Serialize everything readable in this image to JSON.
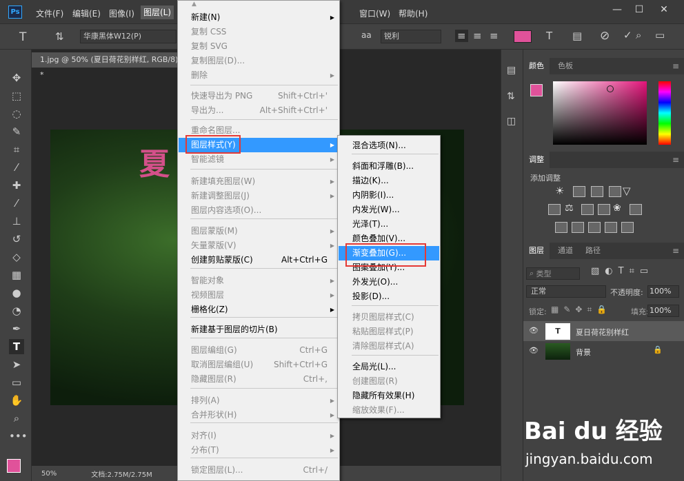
{
  "app": {
    "logo": "Ps",
    "menus": [
      "文件(F)",
      "编辑(E)",
      "图像(I)",
      "图层(L)",
      "窗口(W)",
      "帮助(H)"
    ]
  },
  "options": {
    "font_family": "华康黑体W12(P)",
    "antialias_icon_label": "aa",
    "antialias": "锐利"
  },
  "document": {
    "tab_title": "1.jpg @ 50% (夏日荷花别样红, RGB/8) *",
    "canvas_text": "夏",
    "zoom": "50%",
    "doc_size": "文档:2.75M/2.75M"
  },
  "panels": {
    "color_tabs": [
      "颜色",
      "色板"
    ],
    "adjust_tab": "调整",
    "adjust_label": "添加调整",
    "layers_tabs": [
      "图层",
      "通道",
      "路径"
    ],
    "filter_kind": "类型",
    "blend_mode": "正常",
    "opacity_label": "不透明度:",
    "opacity_value": "100%",
    "lock_label": "锁定:",
    "fill_label": "填充:",
    "fill_value": "100%",
    "layers": [
      {
        "name": "夏日荷花别样红",
        "selected": true
      },
      {
        "name": "背景",
        "selected": false
      }
    ]
  },
  "layer_menu": {
    "items": [
      {
        "label": "新建(N)",
        "shortcut": "",
        "sub": true,
        "disabled": false
      },
      {
        "label": "复制 CSS",
        "shortcut": "",
        "sub": false,
        "disabled": true
      },
      {
        "label": "复制 SVG",
        "shortcut": "",
        "sub": false,
        "disabled": true
      },
      {
        "label": "复制图层(D)...",
        "shortcut": "",
        "sub": false,
        "disabled": true
      },
      {
        "label": "删除",
        "shortcut": "",
        "sub": true,
        "disabled": true
      },
      {
        "label": "快速导出为 PNG",
        "shortcut": "Shift+Ctrl+'",
        "sub": false,
        "disabled": true
      },
      {
        "label": "导出为...",
        "shortcut": "Alt+Shift+Ctrl+'",
        "sub": false,
        "disabled": true
      },
      {
        "label": "重命名图层...",
        "shortcut": "",
        "sub": false,
        "disabled": true
      },
      {
        "label": "图层样式(Y)",
        "shortcut": "",
        "sub": true,
        "disabled": false
      },
      {
        "label": "智能滤镜",
        "shortcut": "",
        "sub": true,
        "disabled": true
      },
      {
        "label": "新建填充图层(W)",
        "shortcut": "",
        "sub": true,
        "disabled": true
      },
      {
        "label": "新建调整图层(J)",
        "shortcut": "",
        "sub": true,
        "disabled": true
      },
      {
        "label": "图层内容选项(O)...",
        "shortcut": "",
        "sub": false,
        "disabled": true
      },
      {
        "label": "图层蒙版(M)",
        "shortcut": "",
        "sub": true,
        "disabled": true
      },
      {
        "label": "矢量蒙版(V)",
        "shortcut": "",
        "sub": true,
        "disabled": true
      },
      {
        "label": "创建剪贴蒙版(C)",
        "shortcut": "Alt+Ctrl+G",
        "sub": false,
        "disabled": false
      },
      {
        "label": "智能对象",
        "shortcut": "",
        "sub": true,
        "disabled": true
      },
      {
        "label": "视频图层",
        "shortcut": "",
        "sub": true,
        "disabled": true
      },
      {
        "label": "栅格化(Z)",
        "shortcut": "",
        "sub": true,
        "disabled": false
      },
      {
        "label": "新建基于图层的切片(B)",
        "shortcut": "",
        "sub": false,
        "disabled": false
      },
      {
        "label": "图层编组(G)",
        "shortcut": "Ctrl+G",
        "sub": false,
        "disabled": true
      },
      {
        "label": "取消图层编组(U)",
        "shortcut": "Shift+Ctrl+G",
        "sub": false,
        "disabled": true
      },
      {
        "label": "隐藏图层(R)",
        "shortcut": "Ctrl+,",
        "sub": false,
        "disabled": true
      },
      {
        "label": "排列(A)",
        "shortcut": "",
        "sub": true,
        "disabled": true
      },
      {
        "label": "合并形状(H)",
        "shortcut": "",
        "sub": true,
        "disabled": true
      },
      {
        "label": "对齐(I)",
        "shortcut": "",
        "sub": true,
        "disabled": true
      },
      {
        "label": "分布(T)",
        "shortcut": "",
        "sub": true,
        "disabled": true
      },
      {
        "label": "锁定图层(L)...",
        "shortcut": "Ctrl+/",
        "sub": false,
        "disabled": true
      }
    ]
  },
  "style_submenu": {
    "items": [
      {
        "label": "混合选项(N)...",
        "disabled": false
      },
      {
        "label": "斜面和浮雕(B)...",
        "disabled": false
      },
      {
        "label": "描边(K)...",
        "disabled": false
      },
      {
        "label": "内阴影(I)...",
        "disabled": false
      },
      {
        "label": "内发光(W)...",
        "disabled": false
      },
      {
        "label": "光泽(T)...",
        "disabled": false
      },
      {
        "label": "颜色叠加(V)...",
        "disabled": false
      },
      {
        "label": "渐变叠加(G)...",
        "disabled": false
      },
      {
        "label": "图案叠加(Y)...",
        "disabled": false
      },
      {
        "label": "外发光(O)...",
        "disabled": false
      },
      {
        "label": "投影(D)...",
        "disabled": false
      },
      {
        "label": "拷贝图层样式(C)",
        "disabled": true
      },
      {
        "label": "粘贴图层样式(P)",
        "disabled": true
      },
      {
        "label": "清除图层样式(A)",
        "disabled": true
      },
      {
        "label": "全局光(L)...",
        "disabled": false
      },
      {
        "label": "创建图层(R)",
        "disabled": true
      },
      {
        "label": "隐藏所有效果(H)",
        "disabled": false
      },
      {
        "label": "缩放效果(F)...",
        "disabled": true
      }
    ]
  },
  "watermark": {
    "logo": "Bai du 经验",
    "url": "jingyan.baidu.com"
  },
  "colors": {
    "foreground": "#e0529a",
    "highlight": "#3399ff",
    "redbox": "#e53935"
  }
}
